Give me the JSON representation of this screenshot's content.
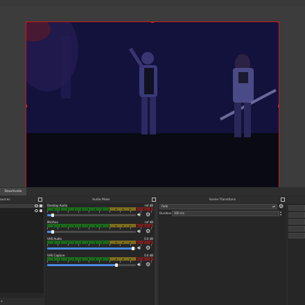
{
  "toolbar": {
    "deactivate_label": "Deactivate"
  },
  "sources": {
    "title": "ources",
    "items": [
      {
        "label": "",
        "visible": true,
        "locked": true
      },
      {
        "label": "",
        "visible": true,
        "locked": true
      }
    ],
    "footer_label": "+"
  },
  "mixer": {
    "title": "Audio Mixer",
    "channels": [
      {
        "name": "Desktop Audio",
        "db": "-inf dB",
        "volume_fraction": 0.06
      },
      {
        "name": "Mic/Aux",
        "db": "-inf dB",
        "volume_fraction": 0.06
      },
      {
        "name": "VHS Audio",
        "db": "0.0 dB",
        "volume_fraction": 0.97
      },
      {
        "name": "VHS Capture",
        "db": "0.0 dB",
        "volume_fraction": 0.78
      }
    ]
  },
  "transitions": {
    "title": "Scene Transitions",
    "selected": "Fade",
    "duration_label": "Duration",
    "duration_value": "300 ms"
  },
  "icons": {
    "volume": "speaker-icon",
    "settings": "gear-icon",
    "float": "float-dock-icon"
  },
  "colors": {
    "selection_border": "#c81a1a",
    "meter_green": "#1c6a1c",
    "meter_yellow": "#7b6d1d",
    "meter_red": "#6e2020",
    "slider_accent": "#4a8ae0"
  }
}
